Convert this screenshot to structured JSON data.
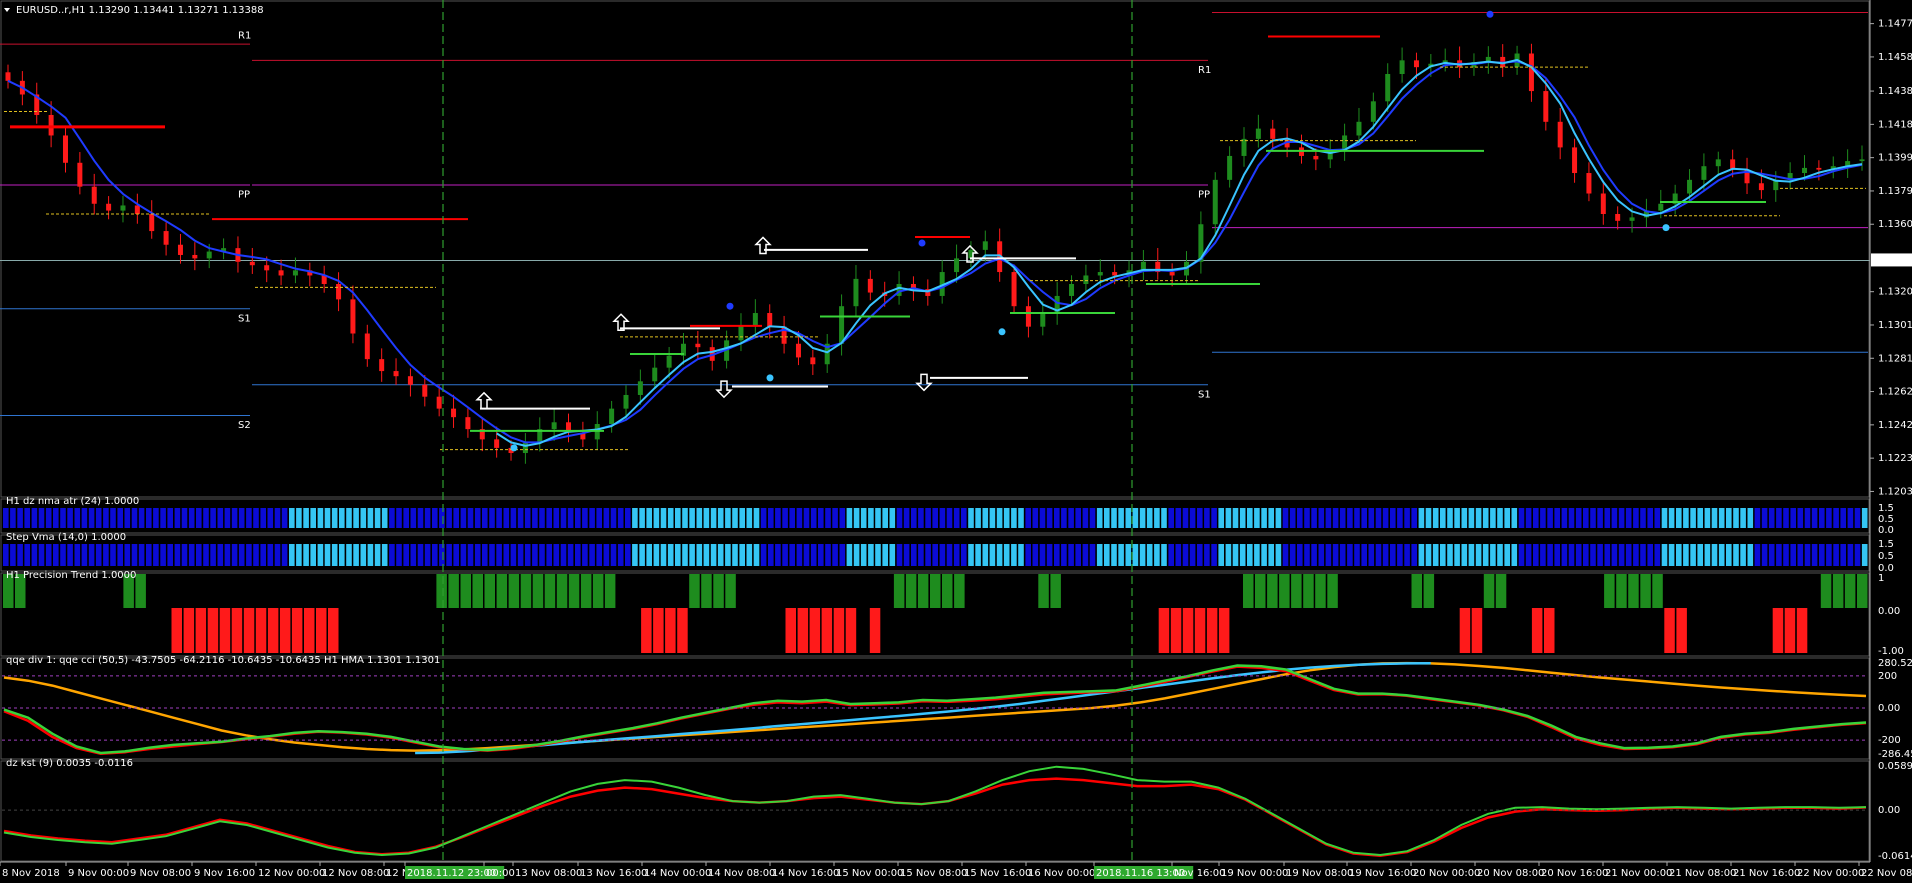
{
  "header": {
    "symbol_line": "EURUSD..r,H1  1.13290 1.13441 1.13271 1.13388",
    "menu_icon": "triangle-down-icon"
  },
  "colors": {
    "bg": "#000000",
    "grid": "#1f1f1f",
    "bull": "#1e8c1e",
    "bear": "#ff1a1a",
    "ma_blue": "#1f3bff",
    "ma_cyan": "#3ac4ff",
    "pivot_red": "#c8102e",
    "pivot_magenta": "#c020c0",
    "pivot_blue": "#2f74d0",
    "orange": "#ffa500",
    "green_line": "#39d439",
    "red_line": "#ff0000",
    "vline": "#2e9e2e",
    "dark_blue_bar": "#0b0bd6",
    "light_blue_bar": "#35c6f4"
  },
  "chart_data": [
    {
      "name": "main",
      "type": "candlestick",
      "price_axis_ticks": [
        "1.14775",
        "1.14580",
        "1.14380",
        "1.14185",
        "1.13990",
        "1.13795",
        "1.13600",
        "1.13205",
        "1.13010",
        "1.12815",
        "1.12620",
        "1.12425",
        "1.12230",
        "1.12035"
      ],
      "current_price": "1.13388",
      "ylim": [
        1.1202,
        1.1489
      ],
      "time_ticks": [
        "8 Nov 2018",
        "9 Nov 00:00",
        "9 Nov 08:00",
        "9 Nov 16:00",
        "12 Nov 00:00",
        "12 Nov 08:00",
        "12 N",
        "2018.11.12 23:00",
        "00:00",
        "13 Nov 08:00",
        "13 Nov 16:00",
        "14 Nov 00:00",
        "14 Nov 08:00",
        "14 Nov 16:00",
        "15 Nov 00:00",
        "15 Nov 08:00",
        "15 Nov 16:00",
        "16 Nov 00:00",
        "2018.11.16 13:00",
        "Nov 16:00",
        "19 Nov 00:00",
        "19 Nov 08:00",
        "19 Nov 16:00",
        "20 Nov 00:00",
        "20 Nov 08:00",
        "20 Nov 16:00",
        "21 Nov 00:00",
        "21 Nov 08:00",
        "21 Nov 16:00",
        "22 Nov 00:00",
        "22 Nov 08:00"
      ],
      "pivot_labels": [
        "R1",
        "PP",
        "S1",
        "S2",
        "R1",
        "PP",
        "S1"
      ],
      "close_path": [
        1.1444,
        1.1436,
        1.1424,
        1.1412,
        1.1396,
        1.1382,
        1.1372,
        1.1368,
        1.1371,
        1.1366,
        1.1356,
        1.1348,
        1.1342,
        1.134,
        1.1344,
        1.1346,
        1.1338,
        1.1336,
        1.1333,
        1.133,
        1.1333,
        1.133,
        1.1325,
        1.1316,
        1.1296,
        1.1281,
        1.1274,
        1.1271,
        1.1266,
        1.1259,
        1.1252,
        1.1247,
        1.124,
        1.1234,
        1.1229,
        1.1226,
        1.1232,
        1.124,
        1.1244,
        1.1238,
        1.1234,
        1.1243,
        1.1252,
        1.126,
        1.1268,
        1.1276,
        1.1283,
        1.129,
        1.1288,
        1.128,
        1.1292,
        1.1301,
        1.1308,
        1.13,
        1.129,
        1.1282,
        1.1278,
        1.129,
        1.1312,
        1.1328,
        1.132,
        1.1318,
        1.1325,
        1.1322,
        1.1318,
        1.1332,
        1.134,
        1.1345,
        1.135,
        1.1332,
        1.1312,
        1.13,
        1.1308,
        1.1318,
        1.1325,
        1.133,
        1.1332,
        1.133,
        1.1333,
        1.1338,
        1.1332,
        1.133,
        1.1338,
        1.136,
        1.1386,
        1.14,
        1.141,
        1.1416,
        1.141,
        1.1405,
        1.14,
        1.1398,
        1.1404,
        1.1412,
        1.142,
        1.1432,
        1.1448,
        1.1456,
        1.1452,
        1.1454,
        1.1456,
        1.1452,
        1.1455,
        1.1458,
        1.1452,
        1.146,
        1.1438,
        1.142,
        1.1405,
        1.139,
        1.1378,
        1.1366,
        1.1362,
        1.1364,
        1.1368,
        1.1372,
        1.1378,
        1.1386,
        1.1394,
        1.1398,
        1.1392,
        1.1384,
        1.138,
        1.1386,
        1.139,
        1.1393,
        1.1392,
        1.1394,
        1.1397,
        1.1398
      ]
    },
    {
      "name": "dz_nma_atr",
      "type": "bar",
      "label": "H1 dz nma atr (24) 1.0000",
      "axis_ticks": [
        "1.5",
        "0.5",
        "0.0"
      ],
      "state_runs": [
        [
          40,
          0
        ],
        [
          14,
          1
        ],
        [
          34,
          0
        ],
        [
          18,
          1
        ],
        [
          12,
          0
        ],
        [
          7,
          1
        ],
        [
          10,
          0
        ],
        [
          8,
          1
        ],
        [
          10,
          0
        ],
        [
          10,
          1
        ],
        [
          7,
          0
        ],
        [
          9,
          1
        ],
        [
          19,
          0
        ],
        [
          14,
          1
        ],
        [
          20,
          0
        ],
        [
          13,
          1
        ],
        [
          15,
          0
        ],
        [
          1,
          1
        ]
      ]
    },
    {
      "name": "step_vma",
      "type": "bar",
      "label": "Step Vma  (14,0) 1.0000",
      "axis_ticks": [
        "1.5",
        "0.5",
        "0.0"
      ],
      "state_runs": [
        [
          40,
          0
        ],
        [
          14,
          1
        ],
        [
          34,
          0
        ],
        [
          18,
          1
        ],
        [
          12,
          0
        ],
        [
          7,
          1
        ],
        [
          10,
          0
        ],
        [
          8,
          1
        ],
        [
          10,
          0
        ],
        [
          10,
          1
        ],
        [
          7,
          0
        ],
        [
          9,
          1
        ],
        [
          19,
          0
        ],
        [
          14,
          1
        ],
        [
          20,
          0
        ],
        [
          13,
          1
        ],
        [
          15,
          0
        ],
        [
          1,
          1
        ]
      ]
    },
    {
      "name": "precision_trend",
      "type": "bar",
      "label": "H1 Precision Trend 1.0000",
      "axis_ticks": [
        "1",
        "0.00",
        "-1.00"
      ],
      "signal_runs": [
        [
          2,
          1
        ],
        [
          8,
          0
        ],
        [
          2,
          1
        ],
        [
          2,
          0
        ],
        [
          14,
          -1
        ],
        [
          8,
          0
        ],
        [
          15,
          1
        ],
        [
          2,
          0
        ],
        [
          4,
          -1
        ],
        [
          4,
          1
        ],
        [
          4,
          0
        ],
        [
          6,
          -1
        ],
        [
          1,
          0
        ],
        [
          1,
          -1
        ],
        [
          1,
          0
        ],
        [
          6,
          1
        ],
        [
          6,
          0
        ],
        [
          2,
          1
        ],
        [
          8,
          0
        ],
        [
          6,
          -1
        ],
        [
          1,
          0
        ],
        [
          8,
          1
        ],
        [
          6,
          0
        ],
        [
          2,
          1
        ],
        [
          2,
          0
        ],
        [
          2,
          -1
        ],
        [
          2,
          1
        ],
        [
          2,
          0
        ],
        [
          2,
          -1
        ],
        [
          4,
          0
        ],
        [
          5,
          1
        ],
        [
          2,
          -1
        ],
        [
          7,
          0
        ],
        [
          3,
          -1
        ],
        [
          1,
          0
        ],
        [
          4,
          1
        ]
      ]
    },
    {
      "name": "qqe",
      "type": "line",
      "label": "qqe div 1: qqe cci (50,5) -43.7505 -64.2116 -10.6435 -10.6435  H1 HMA 1.1301 1.1301",
      "axis_ticks": [
        "280.5289",
        "200",
        "0.00",
        "-200",
        "-286.4581"
      ],
      "ylim": [
        -286.4581,
        280.5289
      ],
      "green_series": [
        -10,
        -60,
        -160,
        -240,
        -280,
        -270,
        -248,
        -230,
        -220,
        -210,
        -190,
        -175,
        -155,
        -145,
        -150,
        -160,
        -180,
        -210,
        -240,
        -255,
        -262,
        -250,
        -230,
        -205,
        -175,
        -150,
        -125,
        -95,
        -60,
        -30,
        0,
        30,
        45,
        40,
        50,
        25,
        30,
        35,
        50,
        45,
        55,
        65,
        80,
        95,
        100,
        105,
        110,
        140,
        170,
        200,
        235,
        265,
        260,
        240,
        180,
        120,
        90,
        90,
        80,
        60,
        40,
        20,
        -10,
        -50,
        -110,
        -180,
        -220,
        -250,
        -248,
        -240,
        -220,
        -180,
        -160,
        -150,
        -130,
        -115,
        -100,
        -90
      ],
      "red_series": [
        -20,
        -80,
        -180,
        -250,
        -285,
        -275,
        -255,
        -240,
        -225,
        -212,
        -195,
        -178,
        -160,
        -148,
        -153,
        -165,
        -185,
        -215,
        -245,
        -258,
        -265,
        -255,
        -235,
        -210,
        -180,
        -155,
        -130,
        -100,
        -65,
        -35,
        -5,
        20,
        35,
        30,
        40,
        18,
        22,
        28,
        42,
        38,
        45,
        55,
        70,
        85,
        92,
        98,
        104,
        132,
        162,
        195,
        228,
        258,
        250,
        230,
        170,
        112,
        84,
        86,
        76,
        55,
        36,
        16,
        -14,
        -55,
        -120,
        -190,
        -230,
        -255,
        -252,
        -244,
        -226,
        -186,
        -165,
        -155,
        -135,
        -120,
        -104,
        -94
      ],
      "orange_series": [
        190,
        170,
        140,
        100,
        60,
        20,
        -20,
        -60,
        -100,
        -140,
        -170,
        -195,
        -215,
        -230,
        -245,
        -255,
        -262,
        -265,
        -263,
        -258,
        -250,
        -240,
        -230,
        -220,
        -210,
        -200,
        -190,
        -180,
        -170,
        -160,
        -150,
        -140,
        -130,
        -120,
        -110,
        -100,
        -90,
        -80,
        -70,
        -60,
        -50,
        -40,
        -30,
        -20,
        -10,
        0,
        15,
        35,
        60,
        90,
        120,
        150,
        180,
        210,
        235,
        255,
        270,
        278,
        280,
        278,
        272,
        262,
        250,
        235,
        220,
        205,
        190,
        178,
        165,
        152,
        140,
        128,
        118,
        108,
        98,
        90,
        82,
        75
      ],
      "cyan_series": [
        null,
        null,
        null,
        null,
        null,
        null,
        null,
        null,
        null,
        null,
        null,
        null,
        null,
        null,
        null,
        null,
        null,
        -280,
        -278,
        -270,
        -260,
        -248,
        -235,
        -222,
        -210,
        -198,
        -186,
        -175,
        -162,
        -150,
        -138,
        -126,
        -112,
        -100,
        -88,
        -75,
        -62,
        -50,
        -36,
        -22,
        -8,
        8,
        25,
        45,
        65,
        85,
        105,
        125,
        145,
        165,
        185,
        205,
        222,
        238,
        252,
        262,
        270,
        275,
        278,
        279,
        null,
        null,
        null,
        null,
        null,
        null,
        null,
        null,
        null,
        null,
        null,
        null,
        null,
        null,
        null,
        null,
        null,
        null
      ]
    },
    {
      "name": "dz_kst",
      "type": "line",
      "label": "dz kst (9) 0.0035 -0.0116",
      "axis_ticks": [
        "0.0589",
        "0.00",
        "-0.0614"
      ],
      "ylim": [
        -0.0614,
        0.0589
      ],
      "green_series": [
        -0.03,
        -0.036,
        -0.04,
        -0.043,
        -0.045,
        -0.04,
        -0.035,
        -0.025,
        -0.015,
        -0.02,
        -0.03,
        -0.04,
        -0.05,
        -0.057,
        -0.06,
        -0.058,
        -0.05,
        -0.035,
        -0.02,
        -0.005,
        0.01,
        0.025,
        0.035,
        0.04,
        0.038,
        0.03,
        0.02,
        0.012,
        0.01,
        0.012,
        0.018,
        0.02,
        0.015,
        0.01,
        0.008,
        0.012,
        0.025,
        0.04,
        0.052,
        0.058,
        0.055,
        0.048,
        0.04,
        0.038,
        0.038,
        0.03,
        0.015,
        -0.005,
        -0.025,
        -0.045,
        -0.057,
        -0.06,
        -0.055,
        -0.04,
        -0.02,
        -0.005,
        0.003,
        0.004,
        0.002,
        0.001,
        0.002,
        0.003,
        0.004,
        0.003,
        0.002,
        0.003,
        0.004,
        0.004,
        0.003,
        0.004
      ],
      "red_series": [
        -0.028,
        -0.034,
        -0.038,
        -0.041,
        -0.043,
        -0.038,
        -0.033,
        -0.023,
        -0.013,
        -0.018,
        -0.028,
        -0.038,
        -0.048,
        -0.056,
        -0.059,
        -0.057,
        -0.049,
        -0.036,
        -0.022,
        -0.008,
        0.006,
        0.018,
        0.026,
        0.03,
        0.028,
        0.022,
        0.016,
        0.012,
        0.01,
        0.012,
        0.016,
        0.018,
        0.014,
        0.01,
        0.008,
        0.012,
        0.022,
        0.034,
        0.04,
        0.042,
        0.04,
        0.036,
        0.032,
        0.032,
        0.034,
        0.028,
        0.014,
        -0.006,
        -0.026,
        -0.046,
        -0.058,
        -0.061,
        -0.056,
        -0.042,
        -0.024,
        -0.01,
        -0.002,
        0.001,
        0.0,
        -0.001,
        0.0,
        0.002,
        0.003,
        0.002,
        0.001,
        0.002,
        0.003,
        0.003,
        0.002,
        0.0035
      ]
    }
  ]
}
